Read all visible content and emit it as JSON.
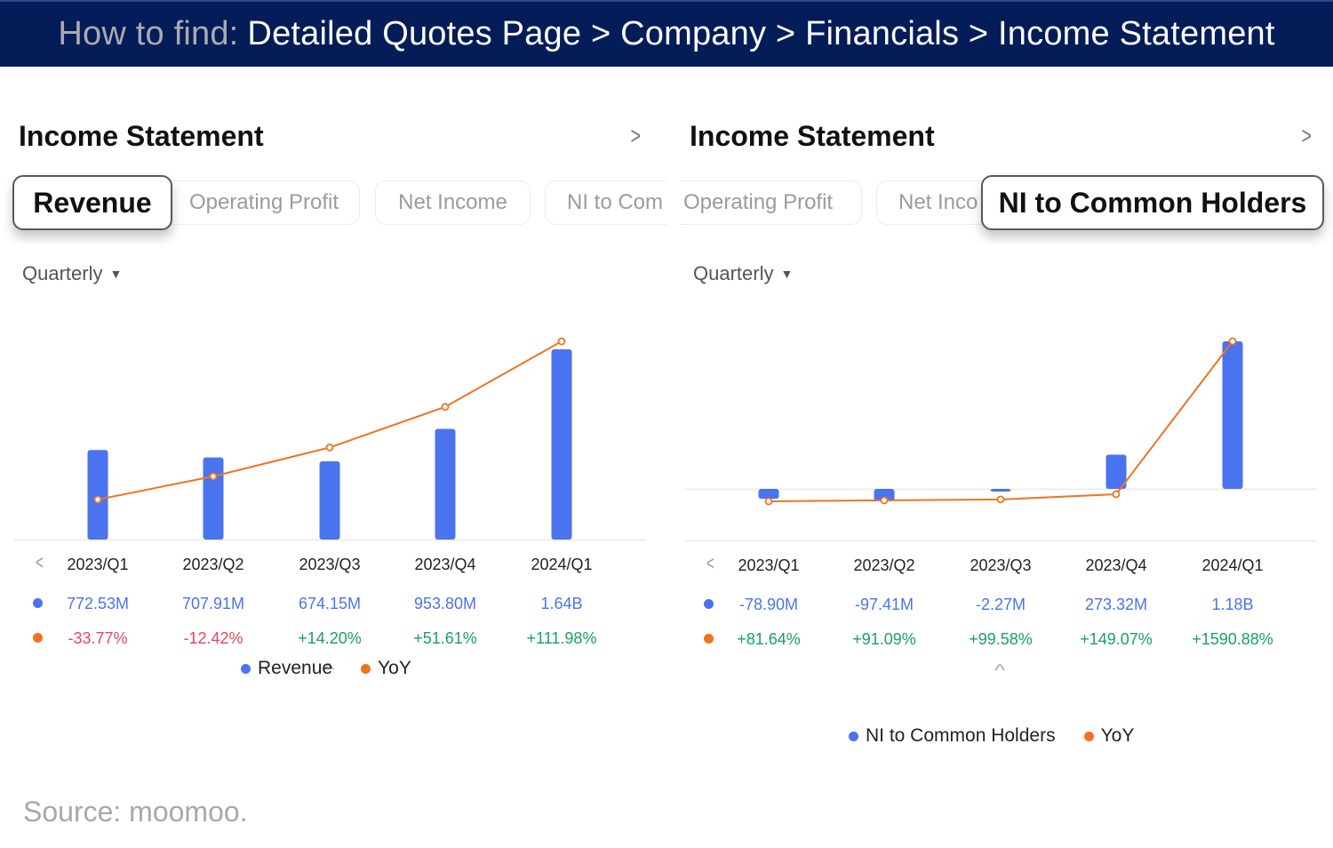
{
  "banner": {
    "lead": "How to find:",
    "path": "Detailed Quotes Page > Company > Financials > Income Statement"
  },
  "colors": {
    "banner_bg": "#041c57",
    "bar": "#4a73f0",
    "line": "#f07320",
    "positive": "#1aa160",
    "negative": "#e8455e"
  },
  "panels": [
    {
      "title": "Income Statement",
      "tabs": [
        "Revenue",
        "Operating Profit",
        "Net Income",
        "NI to Com"
      ],
      "active_tab": "Revenue",
      "period": "Quarterly",
      "quarters": [
        "2023/Q1",
        "2023/Q2",
        "2023/Q3",
        "2023/Q4",
        "2024/Q1"
      ],
      "values_text": [
        "772.53M",
        "707.91M",
        "674.15M",
        "953.80M",
        "1.64B"
      ],
      "yoy_text": [
        "-33.77%",
        "-12.42%",
        "+14.20%",
        "+51.61%",
        "+111.98%"
      ],
      "legend": [
        "Revenue",
        "YoY"
      ]
    },
    {
      "title": "Income Statement",
      "tabs": [
        "Operating Profit",
        "Net Inco",
        "NI to Common Holders"
      ],
      "active_tab": "NI to Common Holders",
      "period": "Quarterly",
      "quarters": [
        "2023/Q1",
        "2023/Q2",
        "2023/Q3",
        "2023/Q4",
        "2024/Q1"
      ],
      "values_text": [
        "-78.90M",
        "-97.41M",
        "-2.27M",
        "273.32M",
        "1.18B"
      ],
      "yoy_text": [
        "+81.64%",
        "+91.09%",
        "+99.58%",
        "+149.07%",
        "+1590.88%"
      ],
      "legend": [
        "NI to Common Holders",
        "YoY"
      ]
    }
  ],
  "chart_data": [
    {
      "type": "bar",
      "title": "Income Statement - Revenue",
      "categories": [
        "2023/Q1",
        "2023/Q2",
        "2023/Q3",
        "2023/Q4",
        "2024/Q1"
      ],
      "series": [
        {
          "name": "Revenue",
          "type": "bar",
          "unit": "USD millions",
          "values": [
            772.53,
            707.91,
            674.15,
            953.8,
            1640
          ]
        },
        {
          "name": "YoY",
          "type": "line",
          "unit": "%",
          "values": [
            -33.77,
            -12.42,
            14.2,
            51.61,
            111.98
          ]
        }
      ],
      "legend": [
        "Revenue",
        "YoY"
      ],
      "legend_position": "bottom",
      "grid": false
    },
    {
      "type": "bar",
      "title": "Income Statement - NI to Common Holders",
      "categories": [
        "2023/Q1",
        "2023/Q2",
        "2023/Q3",
        "2023/Q4",
        "2024/Q1"
      ],
      "series": [
        {
          "name": "NI to Common Holders",
          "type": "bar",
          "unit": "USD millions",
          "values": [
            -78.9,
            -97.41,
            -2.27,
            273.32,
            1180
          ]
        },
        {
          "name": "YoY",
          "type": "line",
          "unit": "%",
          "values": [
            81.64,
            91.09,
            99.58,
            149.07,
            1590.88
          ]
        }
      ],
      "legend": [
        "NI to Common Holders",
        "YoY"
      ],
      "legend_position": "bottom",
      "grid": false
    }
  ],
  "source": "Source: moomoo."
}
